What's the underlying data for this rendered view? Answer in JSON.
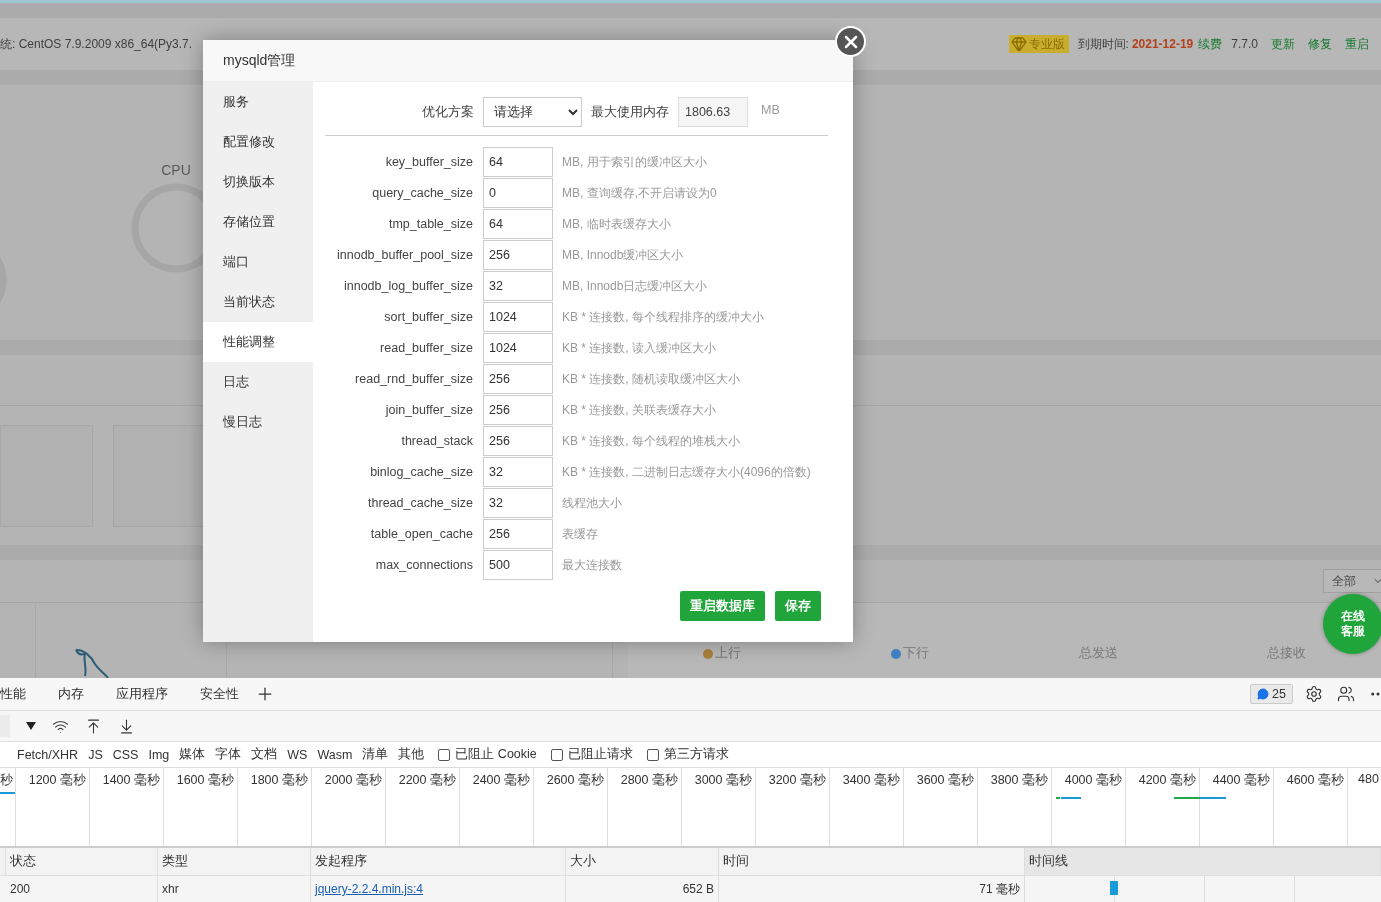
{
  "top_bar": {
    "system_info": "统:  CentOS 7.9.2009 x86_64(Py3.7.",
    "edition": "专业版",
    "expiry_label": "到期时间:",
    "expiry_date": "2021-12-19",
    "renew": "续费",
    "version": "7.7.0",
    "actions": [
      "更新",
      "修复",
      "重启"
    ]
  },
  "dashboard": {
    "gauge_label": "CPU",
    "filter_select": "全部",
    "support_button": "在线客服",
    "network": [
      {
        "label": "上行",
        "color": "#a8803c"
      },
      {
        "label": "下行",
        "color": "#3f7fbf"
      },
      {
        "label": "总发送"
      },
      {
        "label": "总接收"
      }
    ]
  },
  "dialog": {
    "title": "mysqld管理",
    "menu": [
      {
        "label": "服务",
        "selected": false
      },
      {
        "label": "配置修改",
        "selected": false
      },
      {
        "label": "切换版本",
        "selected": false
      },
      {
        "label": "存储位置",
        "selected": false
      },
      {
        "label": "端口",
        "selected": false
      },
      {
        "label": "当前状态",
        "selected": false
      },
      {
        "label": "性能调整",
        "selected": true
      },
      {
        "label": "日志",
        "selected": false
      },
      {
        "label": "慢日志",
        "selected": false
      }
    ],
    "optimization": {
      "label": "优化方案",
      "select": "请选择",
      "memory_label": "最大使用内存",
      "memory_value": "1806.63",
      "memory_unit": "MB"
    },
    "settings": [
      {
        "name": "key_buffer_size",
        "value": "64",
        "hint": "MB, 用于索引的缓冲区大小"
      },
      {
        "name": "query_cache_size",
        "value": "0",
        "hint": "MB, 查询缓存,不开启请设为0"
      },
      {
        "name": "tmp_table_size",
        "value": "64",
        "hint": "MB, 临时表缓存大小"
      },
      {
        "name": "innodb_buffer_pool_size",
        "value": "256",
        "hint": "MB, Innodb缓冲区大小"
      },
      {
        "name": "innodb_log_buffer_size",
        "value": "32",
        "hint": "MB, Innodb日志缓冲区大小"
      },
      {
        "name": "sort_buffer_size",
        "value": "1024",
        "hint": "KB * 连接数, 每个线程排序的缓冲大小"
      },
      {
        "name": "read_buffer_size",
        "value": "1024",
        "hint": "KB * 连接数, 读入缓冲区大小"
      },
      {
        "name": "read_rnd_buffer_size",
        "value": "256",
        "hint": "KB * 连接数, 随机读取缓冲区大小"
      },
      {
        "name": "join_buffer_size",
        "value": "256",
        "hint": "KB * 连接数, 关联表缓存大小"
      },
      {
        "name": "thread_stack",
        "value": "256",
        "hint": "KB * 连接数, 每个线程的堆栈大小"
      },
      {
        "name": "binlog_cache_size",
        "value": "32",
        "hint": "KB * 连接数, 二进制日志缓存大小(4096的倍数)"
      },
      {
        "name": "thread_cache_size",
        "value": "32",
        "hint": "线程池大小"
      },
      {
        "name": "table_open_cache",
        "value": "256",
        "hint": "表缓存"
      },
      {
        "name": "max_connections",
        "value": "500",
        "hint": "最大连接数"
      }
    ],
    "buttons": [
      "重启数据库",
      "保存"
    ]
  },
  "devtools": {
    "tabs": [
      "性能",
      "内存",
      "应用程序",
      "安全性"
    ],
    "message_count": "25",
    "filters": [
      "Fetch/XHR",
      "JS",
      "CSS",
      "Img",
      "媒体",
      "字体",
      "文档",
      "WS",
      "Wasm",
      "清单",
      "其他"
    ],
    "checkboxes": [
      {
        "label": "已阻止 Cookie",
        "checked": false
      },
      {
        "label": "已阻止请求",
        "checked": false
      },
      {
        "label": "第三方请求",
        "checked": false
      }
    ],
    "timeline_ticks": [
      "秒",
      "1200 毫秒",
      "1400 毫秒",
      "1600 毫秒",
      "1800 毫秒",
      "2000 毫秒",
      "2200 毫秒",
      "2400 毫秒",
      "2600 毫秒",
      "2800 毫秒",
      "3000 毫秒",
      "3200 毫秒",
      "3400 毫秒",
      "3600 毫秒",
      "3800 毫秒",
      "4000 毫秒",
      "4200 毫秒",
      "4400 毫秒",
      "4600 毫秒",
      "480"
    ],
    "table": {
      "columns": [
        "状态",
        "类型",
        "发起程序",
        "大小",
        "时间",
        "时间线"
      ],
      "rows": [
        {
          "status": "200",
          "type": "xhr",
          "initiator": "jquery-2.2.4.min.js:4",
          "size": "652 B",
          "time": "71 毫秒"
        }
      ]
    }
  }
}
